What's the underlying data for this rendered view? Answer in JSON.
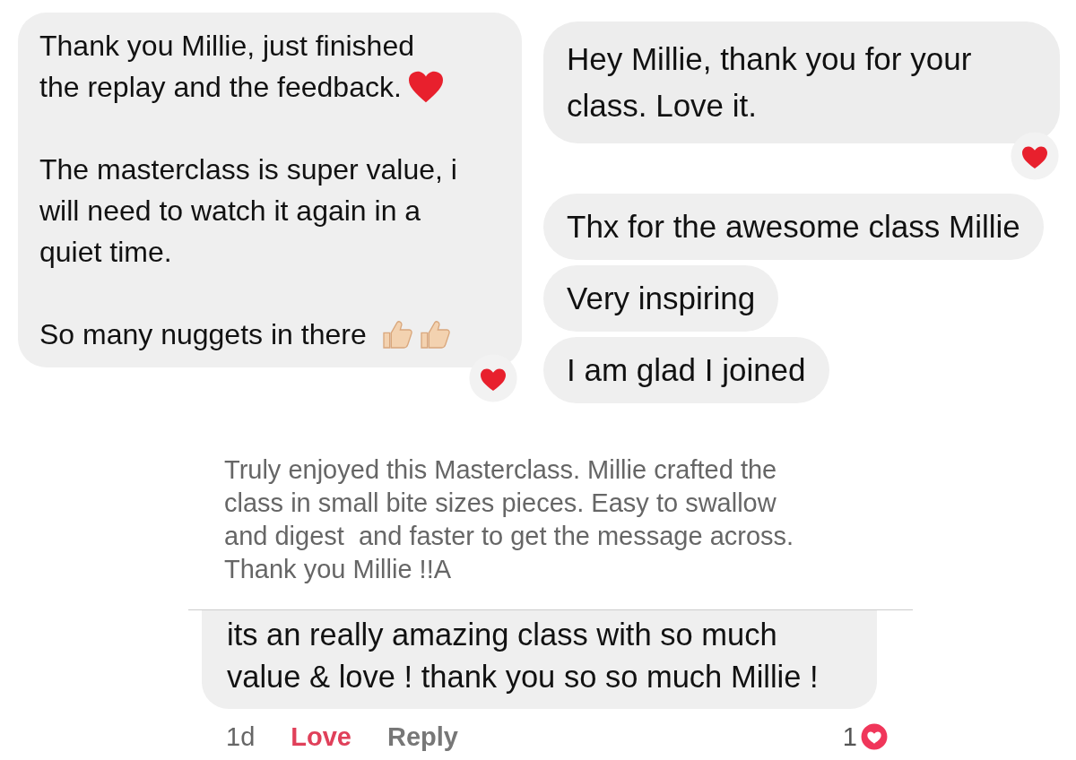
{
  "left_message": {
    "paragraphs": [
      {
        "lines": [
          "Thank you Millie, just finished",
          "the replay and the feedback."
        ]
      },
      {
        "lines": [
          "The masterclass is super value, i",
          "will need to watch it again in a",
          "quiet time."
        ]
      },
      {
        "lines": [
          "So many nuggets in there"
        ]
      }
    ]
  },
  "right_messages": [
    {
      "text": "Hey Millie, thank you for your class. Love it.",
      "reacted": true
    },
    {
      "text": "Thx for the awesome class Millie",
      "reacted": false
    },
    {
      "text": "Very inspiring",
      "reacted": false
    },
    {
      "text": "I am glad I joined",
      "reacted": false
    }
  ],
  "review": {
    "lines": [
      "Truly enjoyed this Masterclass. Millie crafted the",
      "class in small bite sizes pieces. Easy to swallow",
      "and digest  and faster to get the message across.",
      "Thank you Millie !!A"
    ]
  },
  "comment": {
    "text": "its an really amazing class with so much value & love ! thank you so so much Millie !",
    "time": "1d",
    "actions": [
      {
        "label": "Love",
        "selected": true
      },
      {
        "label": "Reply",
        "selected": false
      }
    ],
    "reaction_count": "1"
  }
}
